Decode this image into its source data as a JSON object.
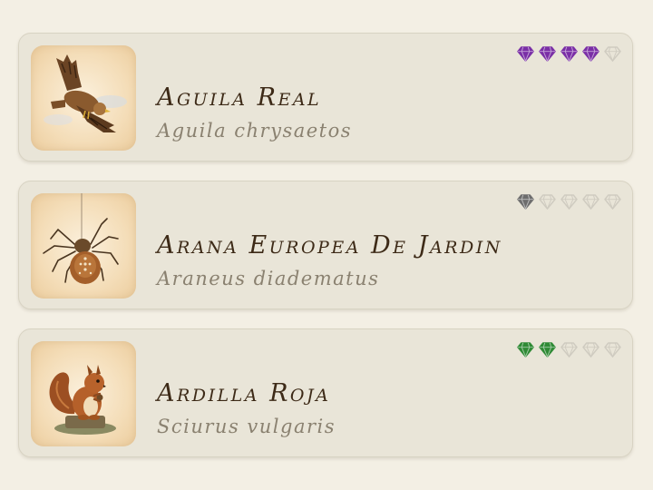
{
  "species": [
    {
      "common_name": "Aguila Real",
      "scientific_name": "Aguila chrysaetos",
      "image_icon": "golden-eagle",
      "rating": 4,
      "rating_max": 5,
      "rating_color": "#7a2fa6"
    },
    {
      "common_name": "Arana Europea De Jardin",
      "scientific_name": "Araneus diadematus",
      "image_icon": "garden-spider",
      "rating": 1,
      "rating_max": 5,
      "rating_color": "#6d6d6d"
    },
    {
      "common_name": "Ardilla Roja",
      "scientific_name": "Sciurus vulgaris",
      "image_icon": "red-squirrel",
      "rating": 2,
      "rating_max": 5,
      "rating_color": "#2f8a35"
    }
  ],
  "colors": {
    "empty_gem": "#cfcbc0",
    "card_background": "#e9e5d8",
    "page_background": "#f3efe4"
  }
}
